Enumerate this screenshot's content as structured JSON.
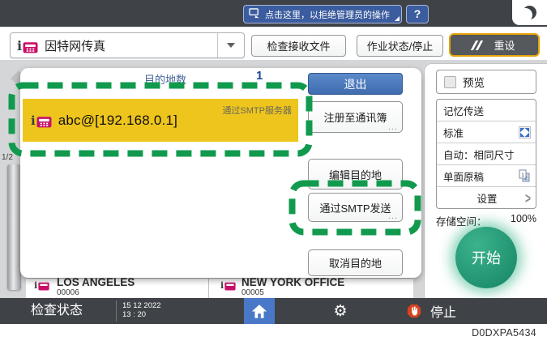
{
  "top_bar": {
    "admin_message": "点击这里，以拒绝管理员的操作",
    "help_label": "?"
  },
  "header": {
    "function_label": "因特网传真",
    "check_received_label": "检查接收文件",
    "job_status_label": "作业状态/停止",
    "reset_label": "重设"
  },
  "popup": {
    "dest_count_label": "目的地数",
    "dest_count": "1",
    "exit_label": "退出",
    "destination": {
      "address": "abc@[192.168.0.1]",
      "via_label": "通过SMTP服务器"
    },
    "register_label": "注册至通讯簿",
    "edit_label": "编辑目的地",
    "send_smtp_label": "通过SMTP发送",
    "cancel_label": "取消目的地"
  },
  "background_screen": {
    "page_indicator": "1/2",
    "items": [
      {
        "name": "LOS ANGELES",
        "number": "00006"
      },
      {
        "name": "NEW YORK OFFICE",
        "number": "00005"
      }
    ]
  },
  "sidebar": {
    "preview_label": "预览",
    "settings": [
      {
        "label": "记忆传送"
      },
      {
        "label": "标准"
      },
      {
        "label": "自动：相同尺寸"
      },
      {
        "label": "单面原稿"
      },
      {
        "label": "设置"
      }
    ],
    "storage_label": "存储空间：",
    "storage_value": "100%",
    "start_label": "开始"
  },
  "bottom_bar": {
    "check_status_label": "检查状态",
    "date": "15 12 2022",
    "time": "13 : 20",
    "stop_label": "停止"
  },
  "caption": "D0DXPA5434",
  "colors": {
    "highlight_yellow": "#eec51c",
    "annotation_green": "#119a4e",
    "start_green": "#1f8f6d",
    "reset_border_gold": "#e3a307",
    "exit_blue": "#4271b5",
    "home_blue": "#4a78c8",
    "stop_red": "#d8431f",
    "bar_gray": "#3f4347",
    "fax_magenta": "#c81069"
  }
}
